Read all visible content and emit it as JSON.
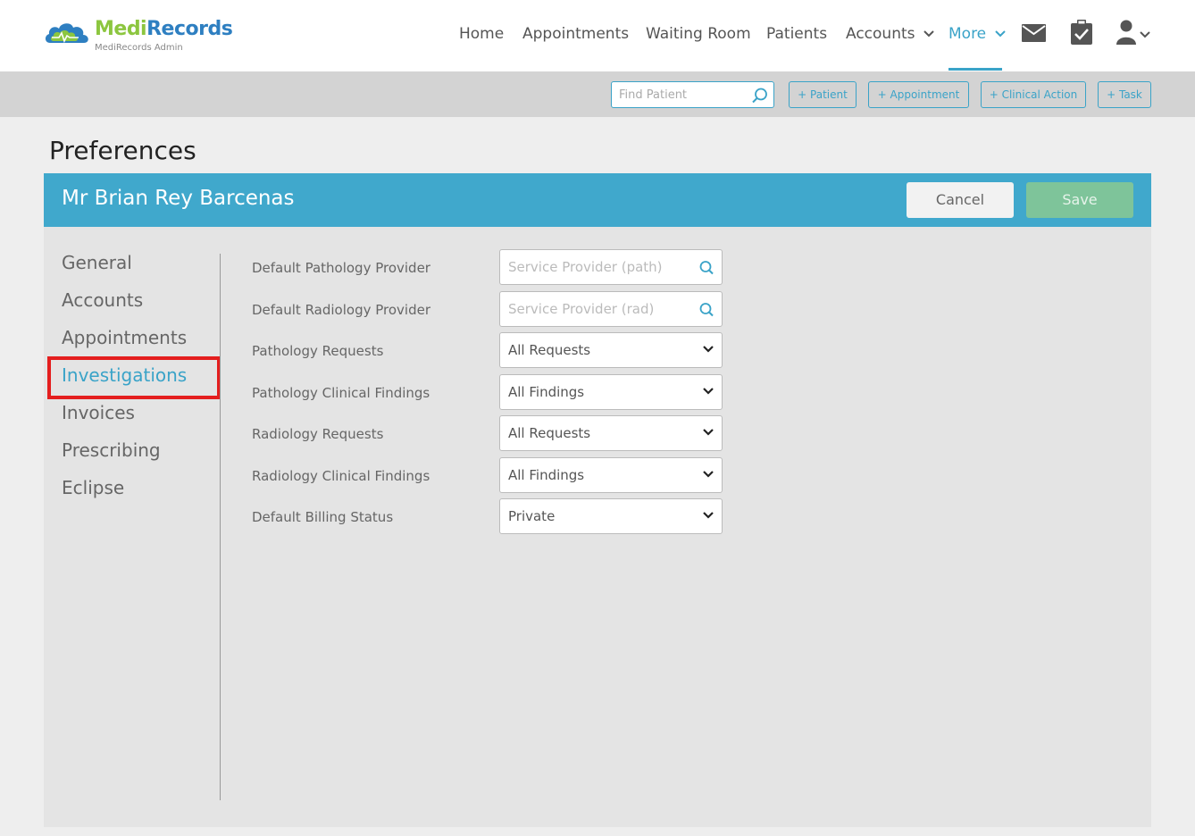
{
  "brand": {
    "name_part1": "Medi",
    "name_part2": "Records",
    "subtitle": "MediRecords Admin",
    "colors": {
      "green": "#8cc63f",
      "blue": "#2e7fc1"
    }
  },
  "nav": {
    "items": [
      {
        "label": "Home"
      },
      {
        "label": "Appointments"
      },
      {
        "label": "Waiting Room"
      },
      {
        "label": "Patients"
      },
      {
        "label": "Accounts"
      },
      {
        "label": "More"
      }
    ],
    "icons": [
      "mail-icon",
      "clipboard-check-icon",
      "user-icon",
      "chevron-down-icon"
    ],
    "active_color": "#3aa3c8"
  },
  "toolbar": {
    "find_placeholder": "Find Patient",
    "buttons": [
      {
        "label": "+ Patient"
      },
      {
        "label": "+ Appointment"
      },
      {
        "label": "+ Clinical Action"
      },
      {
        "label": "+ Task"
      }
    ]
  },
  "page": {
    "title": "Preferences"
  },
  "header": {
    "patient_name": "Mr Brian Rey Barcenas",
    "cancel_label": "Cancel",
    "save_label": "Save",
    "band_color": "#40a8cc"
  },
  "sidebar": {
    "items": [
      {
        "label": "General"
      },
      {
        "label": "Accounts"
      },
      {
        "label": "Appointments"
      },
      {
        "label": "Investigations"
      },
      {
        "label": "Invoices"
      },
      {
        "label": "Prescribing"
      },
      {
        "label": "Eclipse"
      }
    ],
    "active": "Investigations",
    "highlight_color": "#e41e1e"
  },
  "form": {
    "fields": [
      {
        "label": "Default Pathology Provider",
        "placeholder": "Service Provider (path)",
        "type": "search"
      },
      {
        "label": "Default Radiology Provider",
        "placeholder": "Service Provider (rad)",
        "type": "search"
      },
      {
        "label": "Pathology Requests",
        "value": "All Requests",
        "type": "select"
      },
      {
        "label": "Pathology Clinical Findings",
        "value": "All Findings",
        "type": "select"
      },
      {
        "label": "Radiology Requests",
        "value": "All Requests",
        "type": "select"
      },
      {
        "label": "Radiology Clinical Findings",
        "value": "All Findings",
        "type": "select"
      },
      {
        "label": "Default Billing Status",
        "value": "Private",
        "type": "select"
      }
    ]
  }
}
